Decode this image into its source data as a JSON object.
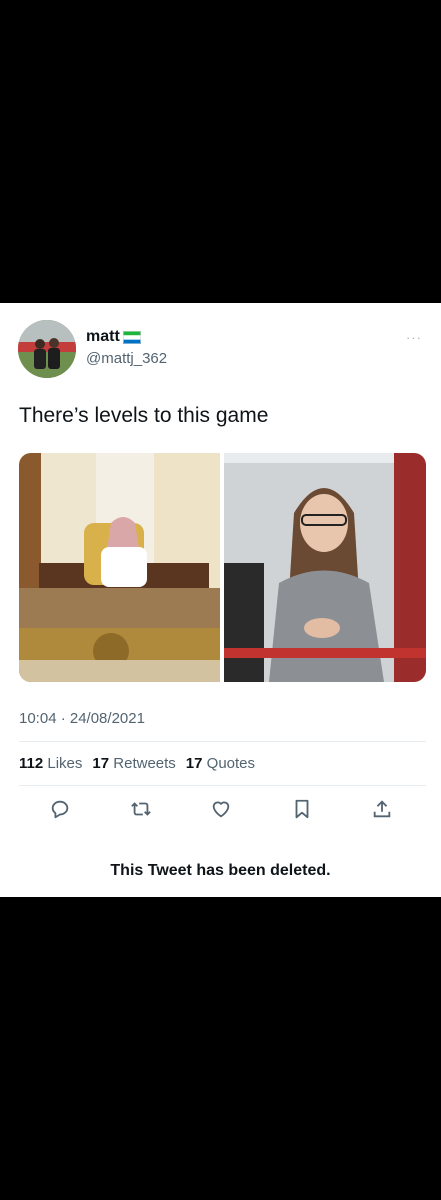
{
  "tweet": {
    "display_name": "matt",
    "handle": "@mattj_362",
    "more_label": "···",
    "text": "There’s levels to this game",
    "timestamp": "10:04 · 24/08/2021",
    "stats": [
      {
        "count": "112",
        "label": "Likes"
      },
      {
        "count": "17",
        "label": "Retweets"
      },
      {
        "count": "17",
        "label": "Quotes"
      }
    ],
    "actions": [
      "reply-icon",
      "retweet-icon",
      "like-icon",
      "bookmark-icon",
      "share-icon"
    ],
    "deleted_notice": "This Tweet has been deleted."
  },
  "colors": {
    "background": "#000000",
    "card": "#ffffff",
    "text_primary": "#0f1419",
    "text_secondary": "#536471",
    "accent": "#1d9bf0"
  }
}
